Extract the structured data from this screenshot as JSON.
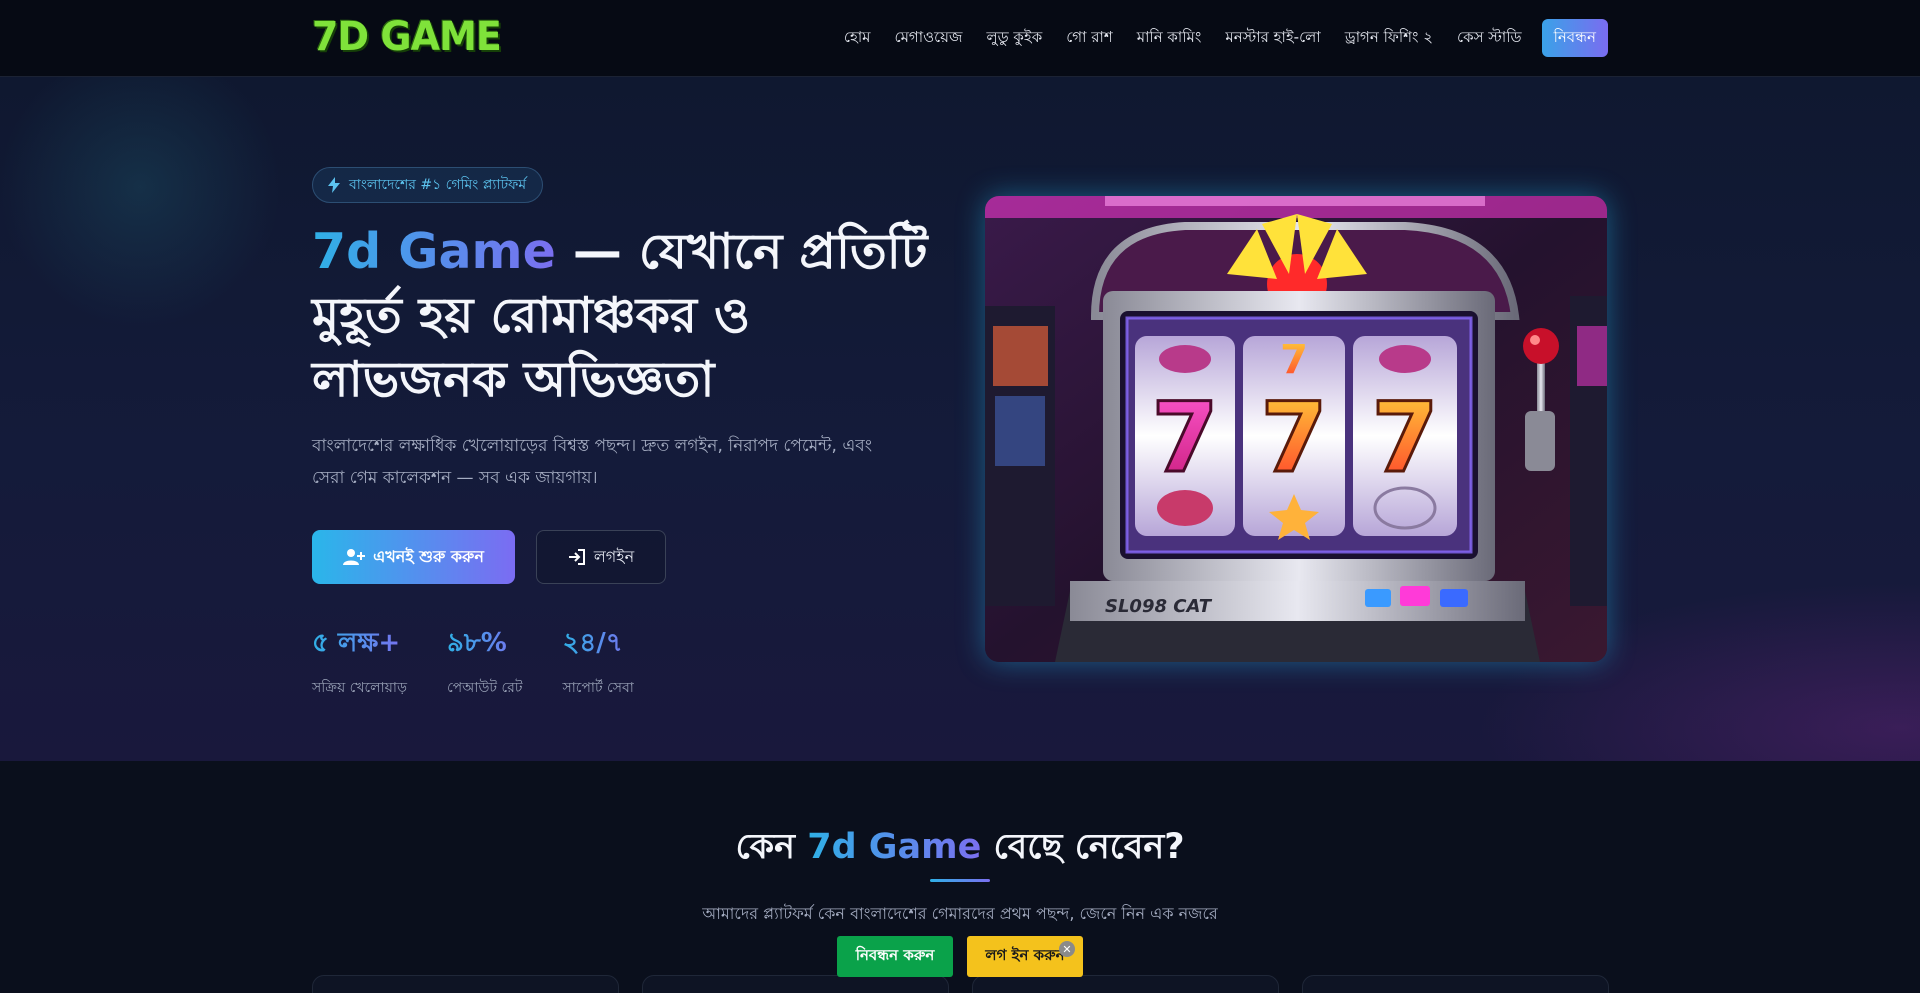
{
  "header": {
    "logo": "7D GAME",
    "nav": [
      "হোম",
      "মেগাওয়েজ",
      "লুডু কুইক",
      "গো রাশ",
      "মানি কামিং",
      "মনস্টার হাই-লো",
      "ড্রাগন ফিশিং ২",
      "কেস স্টাডি"
    ],
    "cta": "নিবন্ধন"
  },
  "hero": {
    "badge": "বাংলাদেশের #১ গেমিং প্ল্যাটফর্ম",
    "title_brand": "7d Game",
    "title_rest": " — যেখানে প্রতিটি মুহূর্ত হয় রোমাঞ্চকর ও লাভজনক অভিজ্ঞতা",
    "subtitle": "বাংলাদেশের লক্ষাধিক খেলোয়াড়ের বিশ্বস্ত পছন্দ। দ্রুত লগইন, নিরাপদ পেমেন্ট, এবং সেরা গেম কালেকশন — সব এক জায়গায়।",
    "primary_button": "এখনই শুরু করুন",
    "secondary_button": "লগইন",
    "stats": [
      {
        "value": "৫ লক্ষ+",
        "label": "সক্রিয় খেলোয়াড়"
      },
      {
        "value": "৯৮%",
        "label": "পেআউট রেট"
      },
      {
        "value": "২৪/৭",
        "label": "সাপোর্ট সেবা"
      }
    ],
    "image_text": "SL098 CAT"
  },
  "why": {
    "title_prefix": "কেন ",
    "title_brand": "7d Game",
    "title_suffix": " বেছে নেবেন?",
    "subtitle": "আমাদের প্ল্যাটফর্ম কেন বাংলাদেশের গেমারদের প্রথম পছন্দ, জেনে নিন এক নজরে"
  },
  "floating": {
    "register": "নিবন্ধন করুন",
    "login": "লগ ইন করুন",
    "close": "✕"
  },
  "colors": {
    "accent_start": "#2fb0e6",
    "accent_end": "#7b6ff0",
    "register_green": "#0aa24a",
    "login_yellow": "#f4c21c",
    "logo_green": "#7fe23a"
  }
}
